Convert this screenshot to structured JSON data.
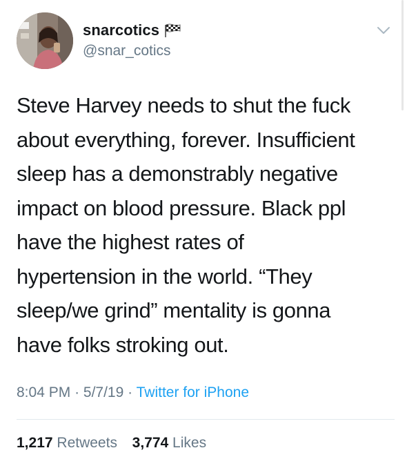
{
  "user": {
    "display_name": "snarcotics",
    "handle": "@snar_cotics",
    "name_badge_icon": "checkered-flag-icon",
    "avatar_icon": "profile-photo"
  },
  "tweet": {
    "lines": [
      "Steve Harvey needs to shut the fuck",
      "about everything, forever. Insufficient",
      "sleep has a demonstrably negative",
      "impact on blood pressure. Black ppl",
      "have the highest rates of",
      "hypertension in the world. “They",
      "sleep/we grind” mentality is gonna",
      "have folks stroking out."
    ]
  },
  "meta": {
    "time": "8:04 PM",
    "separator": "·",
    "date": "5/7/19",
    "source": "Twitter for iPhone"
  },
  "stats": {
    "retweets_count": "1,217",
    "retweets_label": "Retweets",
    "likes_count": "3,774",
    "likes_label": "Likes"
  },
  "colors": {
    "text": "#14171a",
    "secondary": "#657786",
    "link": "#1da1f2",
    "divider": "#e1e8ed"
  }
}
